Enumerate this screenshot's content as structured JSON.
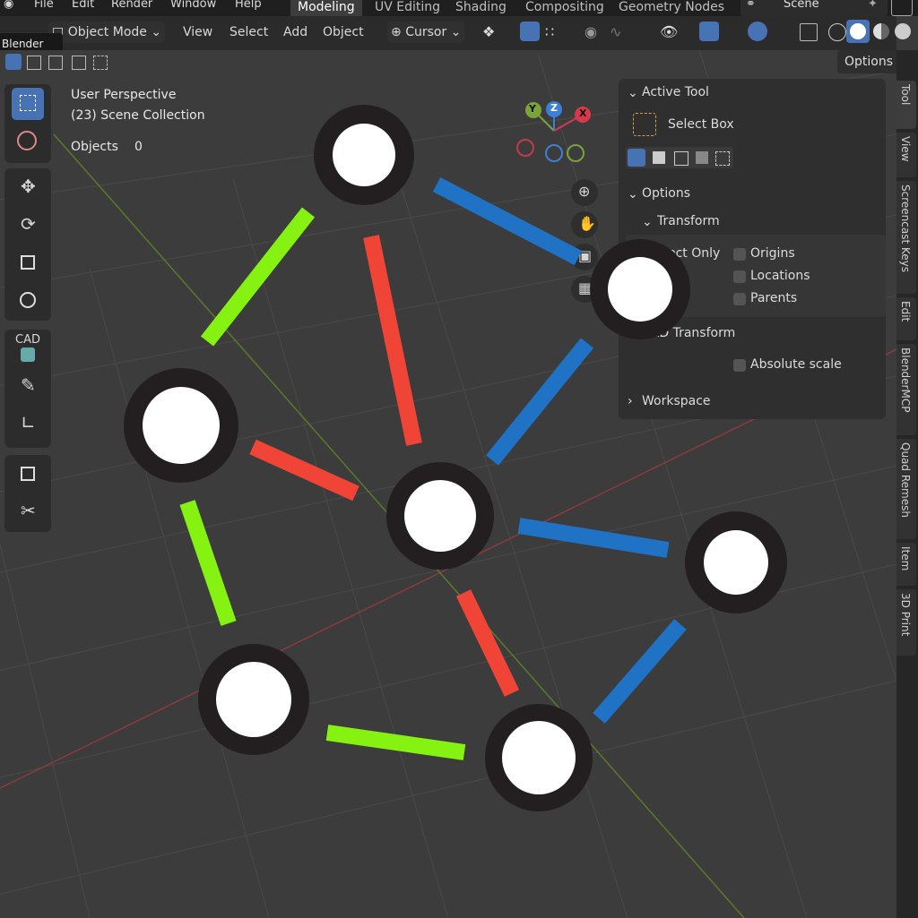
{
  "menubar": {
    "file": "File",
    "edit": "Edit",
    "render": "Render",
    "window": "Window",
    "help": "Help"
  },
  "workspaces": [
    "Modeling",
    "UV Editing",
    "Shading",
    "Compositing",
    "Geometry Nodes"
  ],
  "scene_name": "Scene",
  "tooltip": "Blender",
  "header": {
    "mode": "Object Mode",
    "view": "View",
    "select": "Select",
    "add": "Add",
    "object": "Object",
    "pivot": "Cursor"
  },
  "options_button": "Options",
  "viewport": {
    "perspective": "User Perspective",
    "collection": "(23) Scene Collection",
    "objects_label": "Objects",
    "objects_count": "0"
  },
  "npanel": {
    "active_tool": "Active Tool",
    "select_box": "Select Box",
    "options": "Options",
    "transform": "Transform",
    "affect_only": "ect Only",
    "origins": "Origins",
    "locations": "Locations",
    "parents": "Parents",
    "cad_transform": "CAD Transform",
    "absolute_scale": "Absolute scale",
    "workspace": "Workspace"
  },
  "side_tabs": [
    "Tool",
    "View",
    "Screencast Keys",
    "Edit",
    "BlenderMCP",
    "Quad Remesh",
    "Item",
    "3D Print"
  ],
  "gizmo": {
    "x": "X",
    "y": "Y",
    "z": "Z"
  },
  "graph": {
    "node_fill": "#ffffff",
    "node_ring": "#231f20",
    "edge_colors": {
      "green": "#85f212",
      "red": "#f04536",
      "blue": "#1f72c4"
    }
  },
  "toolbar_icons": [
    "select-box-icon",
    "cursor-icon",
    "move-icon",
    "rotate-icon",
    "scale-icon",
    "transform-icon",
    "cad-icon",
    "annotate-icon",
    "measure-icon",
    "add-cube-icon",
    "extrude-icon"
  ]
}
